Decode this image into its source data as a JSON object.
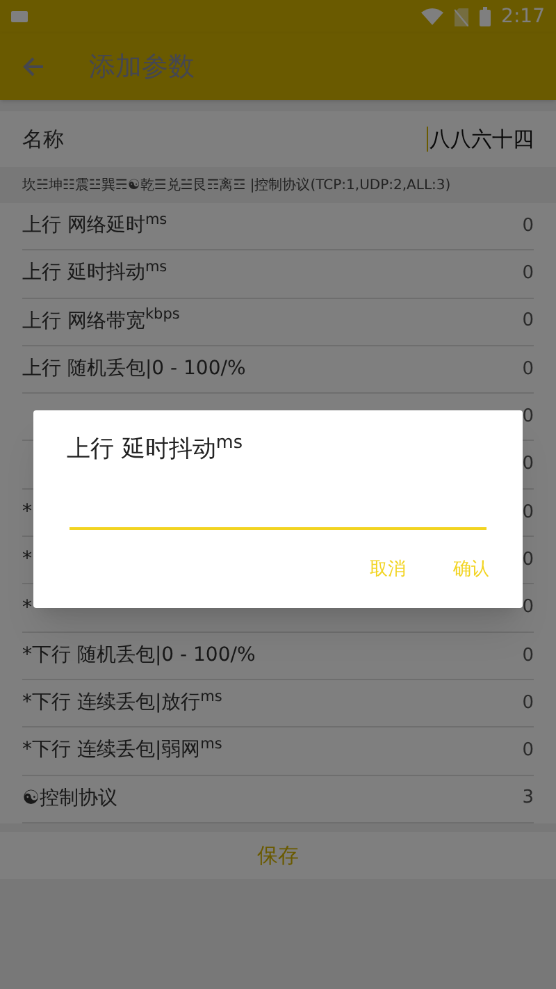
{
  "status_bar": {
    "time": "2:17"
  },
  "app_bar": {
    "title": "添加参数"
  },
  "name_field": {
    "label": "名称",
    "value": "八八六十四"
  },
  "hint": "坎☵坤☷震☳巽☴☯乾☰兑☱艮☶离☲ |控制协议(TCP:1,UDP:2,ALL:3)",
  "params": [
    {
      "label": "上行 网络延时$^{ms}$",
      "value": "0"
    },
    {
      "label": "上行 延时抖动$^{ms}$",
      "value": "0"
    },
    {
      "label": "上行 网络带宽$^{kbps}$",
      "value": "0"
    },
    {
      "label": "上行 随机丢包|0 - 100/%",
      "value": "0"
    },
    {
      "value": "0"
    },
    {
      "value": "0"
    },
    {
      "label": "*",
      "value": "0"
    },
    {
      "label": "*",
      "value": "0"
    },
    {
      "label": "*",
      "value": "0"
    },
    {
      "label": "*下行 随机丢包|0 - 100/%",
      "value": "0"
    },
    {
      "label": "*下行 连续丢包|放行$^{ms}$",
      "value": "0"
    },
    {
      "label": "*下行 连续丢包|弱网$^{ms}$",
      "value": "0"
    },
    {
      "label": "☯控制协议",
      "value": "3"
    }
  ],
  "save_button": "保存",
  "dialog": {
    "title": "上行 延时抖动$^{ms}$",
    "buttons": [
      "取消",
      "确认"
    ]
  }
}
